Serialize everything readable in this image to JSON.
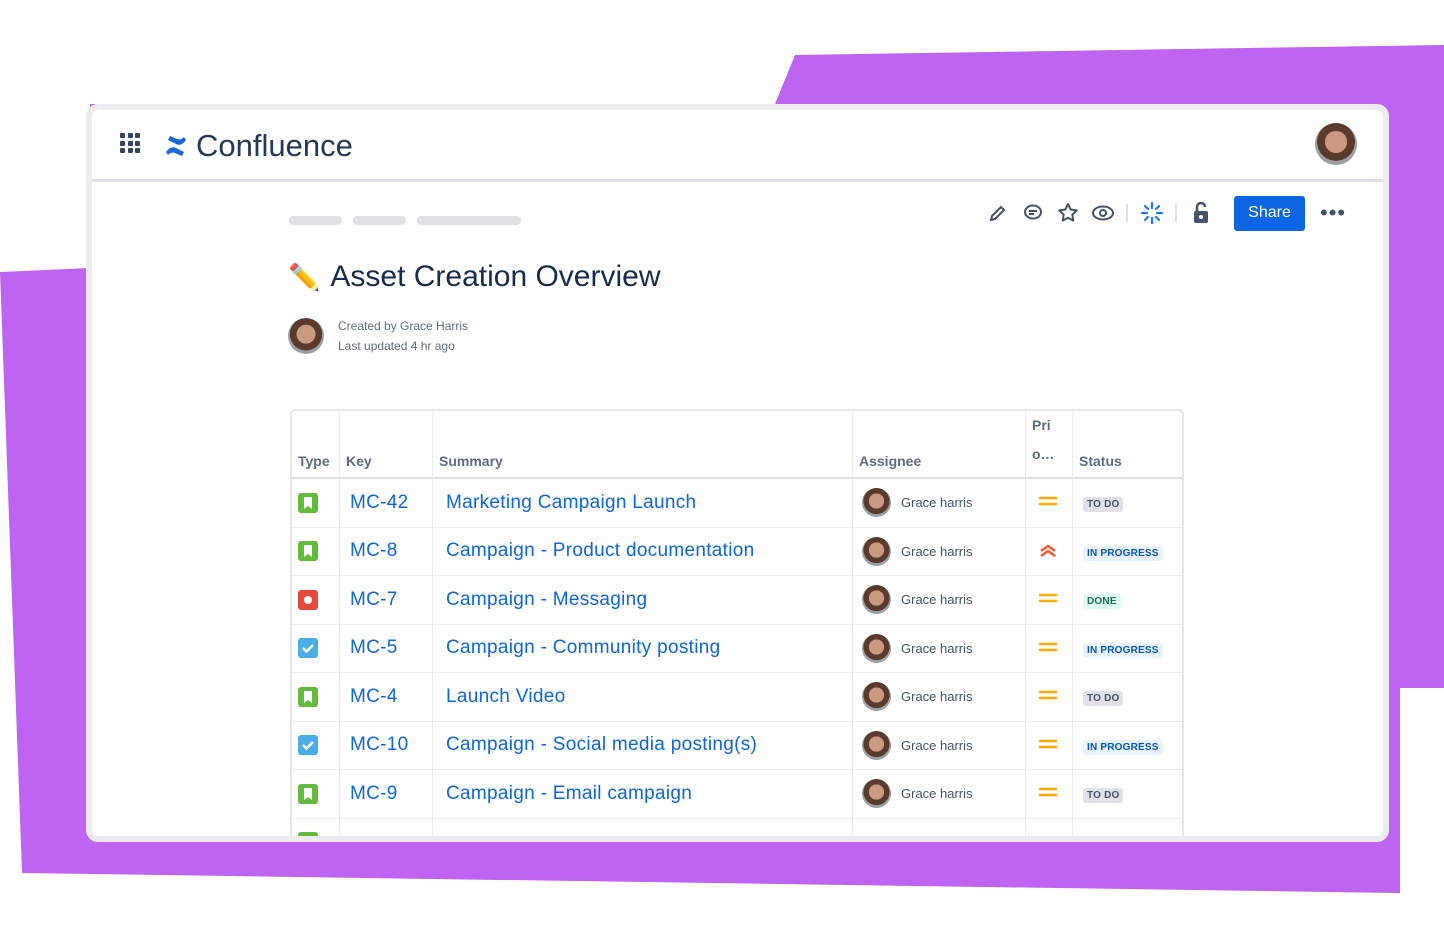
{
  "app": {
    "name": "Confluence"
  },
  "toolbar": {
    "share_label": "Share",
    "icons": [
      "edit-icon",
      "comment-icon",
      "star-icon",
      "watch-icon",
      "loading-icon",
      "unlock-icon",
      "more-icon"
    ]
  },
  "page": {
    "title": "Asset Creation Overview",
    "title_icon": "pencil-emoji",
    "created_label": "Created by",
    "author": "Grace Harris",
    "updated_label": "Last updated",
    "updated": "4 hr ago"
  },
  "table": {
    "headers": [
      "Type",
      "Key",
      "Summary",
      "Assignee",
      "Prio…",
      "Status"
    ],
    "priority_header": {
      "line1": "Pri",
      "line2": "o…"
    },
    "rows": [
      {
        "type": "story",
        "key": "MC-42",
        "summary": "Marketing Campaign Launch",
        "assignee": "Grace harris",
        "priority": "medium",
        "status": "TO DO"
      },
      {
        "type": "story",
        "key": "MC-8",
        "summary": "Campaign - Product documentation",
        "assignee": "Grace harris",
        "priority": "highest",
        "status": "IN PROGRESS"
      },
      {
        "type": "bug",
        "key": "MC-7",
        "summary": "Campaign - Messaging",
        "assignee": "Grace harris",
        "priority": "medium",
        "status": "DONE"
      },
      {
        "type": "task",
        "key": "MC-5",
        "summary": "Campaign - Community posting",
        "assignee": "Grace harris",
        "priority": "medium",
        "status": "IN PROGRESS"
      },
      {
        "type": "story",
        "key": "MC-4",
        "summary": "Launch Video",
        "assignee": "Grace harris",
        "priority": "medium",
        "status": "TO DO"
      },
      {
        "type": "task",
        "key": "MC-10",
        "summary": "Campaign - Social media posting(s)",
        "assignee": "Grace harris",
        "priority": "medium",
        "status": "IN PROGRESS"
      },
      {
        "type": "story",
        "key": "MC-9",
        "summary": "Campaign - Email campaign",
        "assignee": "Grace harris",
        "priority": "medium",
        "status": "TO DO"
      }
    ]
  },
  "colors": {
    "accent": "#0c66e4",
    "background_shape": "#bf63f3",
    "story": "#63ba3c",
    "bug": "#e5493a",
    "task": "#4bade8",
    "medium": "#ffab00",
    "highest": "#ff5630"
  }
}
